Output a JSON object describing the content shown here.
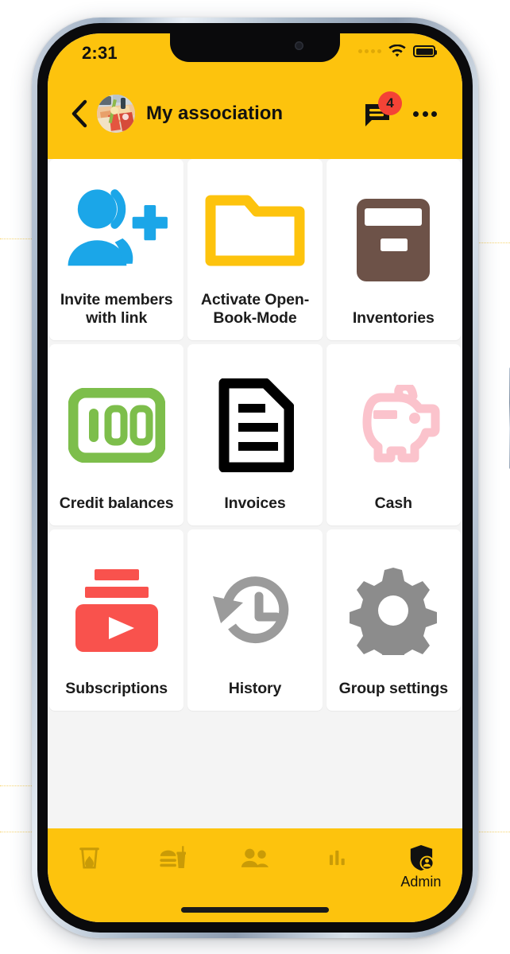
{
  "statusbar": {
    "time": "2:31",
    "signal_icon": "signal-dots-icon",
    "wifi_icon": "wifi-icon",
    "battery_icon": "battery-full-icon"
  },
  "appbar": {
    "back_icon": "back-chevron-icon",
    "avatar_icon": "group-avatar-photo",
    "title": "My association",
    "chat_icon": "chat-bubble-icon",
    "chat_badge_count": "4",
    "overflow_icon": "more-options-icon"
  },
  "grid": {
    "tiles": [
      {
        "label": "Invite members with link",
        "icon": "person-add-icon",
        "color": "#1BA6E8"
      },
      {
        "label": "Activate Open-Book-Mode",
        "icon": "open-folder-icon",
        "color": "#FDC30D"
      },
      {
        "label": "Inventories",
        "icon": "archive-box-icon",
        "color": "#6D5248"
      },
      {
        "label": "Credit balances",
        "icon": "banknote-100-icon",
        "color": "#7DBE4B"
      },
      {
        "label": "Invoices",
        "icon": "document-lines-icon",
        "color": "#000000"
      },
      {
        "label": "Cash",
        "icon": "piggy-bank-icon",
        "color": "#FBC3CC"
      },
      {
        "label": "Subscriptions",
        "icon": "subscriptions-play-icon",
        "color": "#F9524D"
      },
      {
        "label": "History",
        "icon": "history-clock-icon",
        "color": "#9B9B9B"
      },
      {
        "label": "Group settings",
        "icon": "gear-icon",
        "color": "#8C8C8C"
      }
    ]
  },
  "bottomnav": {
    "items": [
      {
        "label": "",
        "icon": "drink-glass-icon",
        "active": false
      },
      {
        "label": "",
        "icon": "food-meal-icon",
        "active": false
      },
      {
        "label": "",
        "icon": "people-icon",
        "active": false
      },
      {
        "label": "",
        "icon": "bar-chart-icon",
        "active": false
      },
      {
        "label": "Admin",
        "icon": "admin-shield-icon",
        "active": true
      }
    ]
  },
  "theme": {
    "accent_yellow": "#FDC30D",
    "nav_inactive": "#C99B07",
    "nav_active": "#111111",
    "badge_red": "#F44336",
    "page_bg": "#F4F4F4",
    "tile_bg": "#FFFFFF"
  }
}
